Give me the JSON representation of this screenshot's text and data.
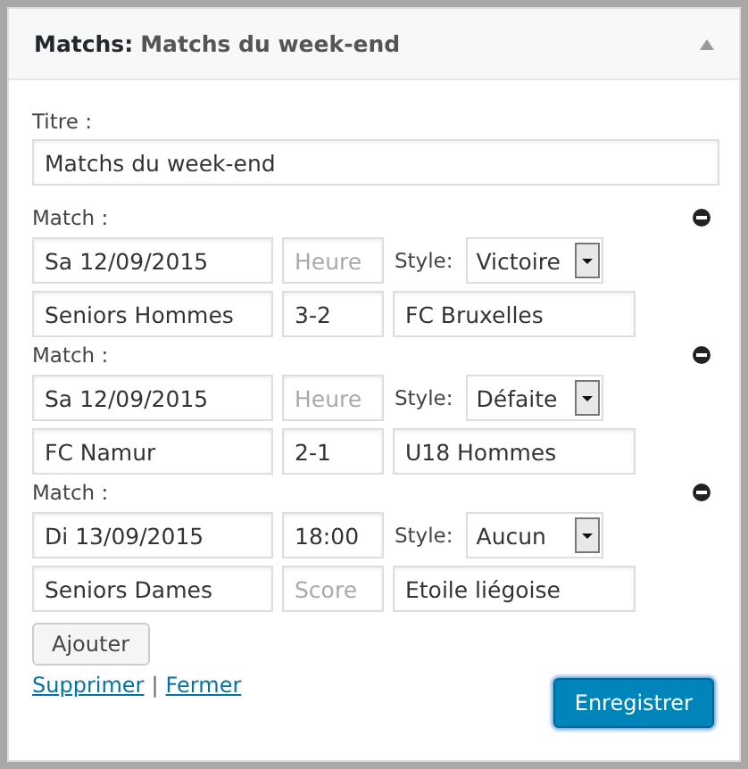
{
  "header": {
    "widget": "Matchs:",
    "title": "Matchs du week-end",
    "expanded": true
  },
  "title_field": {
    "label": "Titre :",
    "value": "Matchs du week-end"
  },
  "matches": [
    {
      "label": "Match :",
      "date": {
        "value": "Sa 12/09/2015"
      },
      "time": {
        "placeholder": "Heure"
      },
      "style_label": "Style:",
      "style": "Victoire",
      "team": {
        "value": "Seniors Hommes"
      },
      "score": {
        "value": "3-2"
      },
      "opponent": {
        "value": "FC Bruxelles"
      }
    },
    {
      "label": "Match :",
      "date": {
        "value": "Sa 12/09/2015"
      },
      "time": {
        "placeholder": "Heure"
      },
      "style_label": "Style:",
      "style": "Défaite",
      "team": {
        "value": "FC Namur"
      },
      "score": {
        "value": "2-1"
      },
      "opponent": {
        "value": "U18 Hommes"
      }
    },
    {
      "label": "Match :",
      "date": {
        "value": "Di 13/09/2015"
      },
      "time": {
        "value": "18:00"
      },
      "style_label": "Style:",
      "style": "Aucun",
      "team": {
        "value": "Seniors Dames"
      },
      "score": {
        "placeholder": "Score"
      },
      "opponent": {
        "value": "Etoile liégoise"
      }
    }
  ],
  "add_button": "Ajouter",
  "links": [
    "Supprimer",
    "Fermer"
  ],
  "separator": "|",
  "save_button": "Enregistrer"
}
